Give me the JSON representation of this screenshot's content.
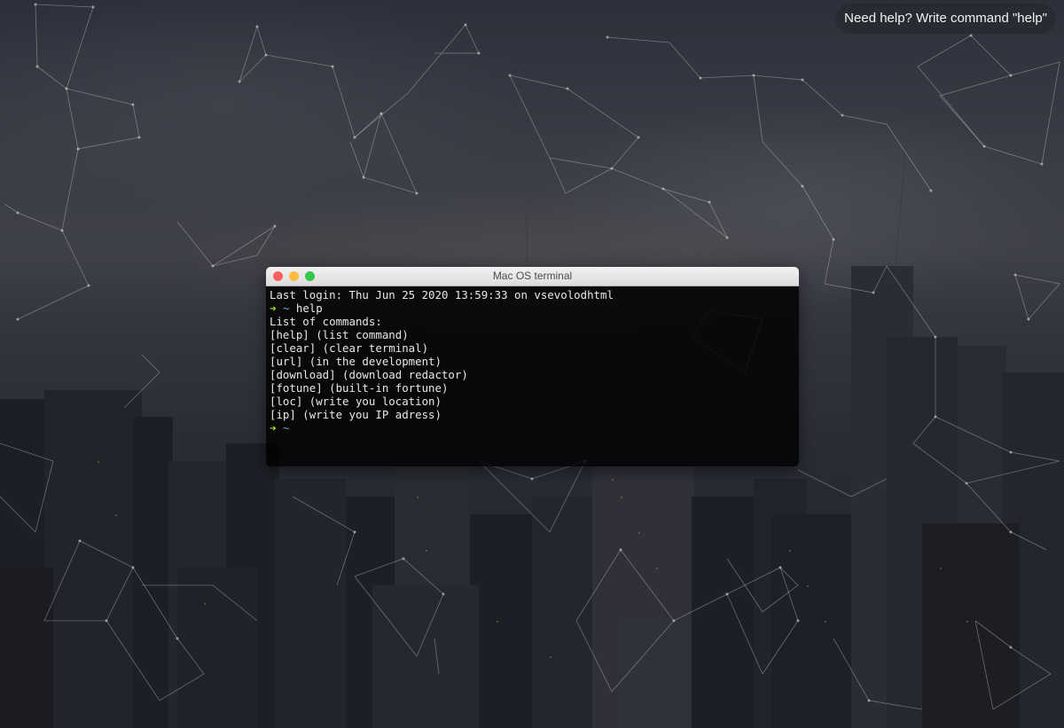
{
  "help_tooltip": "Need help? Write command \"help\"",
  "terminal": {
    "title": "Mac OS terminal",
    "lines": [
      {
        "type": "text",
        "text": "Last login: Thu Jun 25 2020 13:59:33 on vsevolodhtml"
      },
      {
        "type": "prompt",
        "arrow": "➜",
        "dir": "~",
        "cmd": "help"
      },
      {
        "type": "text",
        "text": "List of commands:"
      },
      {
        "type": "text",
        "text": "[help] (list command)"
      },
      {
        "type": "text",
        "text": "[clear] (clear terminal)"
      },
      {
        "type": "text",
        "text": "[url] (in the development)"
      },
      {
        "type": "text",
        "text": "[download] (download redactor)"
      },
      {
        "type": "text",
        "text": "[fotune] (built-in fortune)"
      },
      {
        "type": "text",
        "text": "[loc] (write you location)"
      },
      {
        "type": "text",
        "text": "[ip] (write you IP adress)"
      },
      {
        "type": "prompt",
        "arrow": "➜",
        "dir": "~",
        "cmd": ""
      }
    ]
  },
  "colors": {
    "arrow": "#a6e22e",
    "dir": "#5ab4c8",
    "btn_close": "#fc605c",
    "btn_minimize": "#fdbc40",
    "btn_maximize": "#34c84a"
  }
}
